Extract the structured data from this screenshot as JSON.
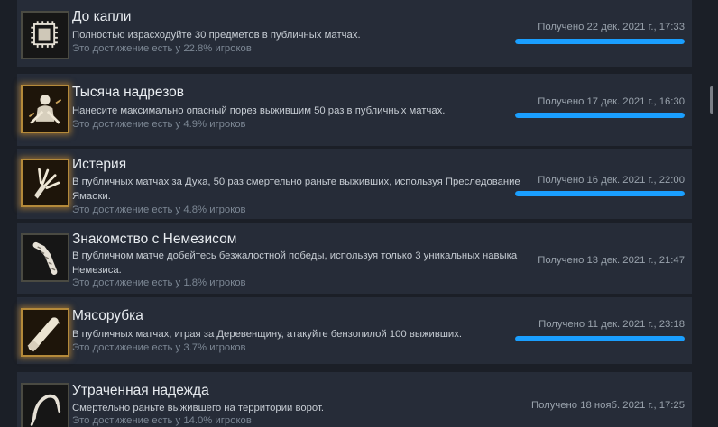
{
  "achievements": [
    {
      "title": "До капли",
      "description": "Полностью израсходуйте 30 предметов в публичных матчах.",
      "percent": "Это достижение есть у 22.8% игроков",
      "unlocked": "Получено 22 дек. 2021 г., 17:33",
      "progress": 1.0,
      "icon": "box-icon"
    },
    {
      "title": "Тысяча надрезов",
      "description": "Нанесите максимально опасный порез выжившим 50 раз в публичных матчах.",
      "percent": "Это достижение есть у 4.9% игроков",
      "unlocked": "Получено 17 дек. 2021 г., 16:30",
      "progress": 1.0,
      "icon": "cutter-icon"
    },
    {
      "title": "Истерия",
      "description": "В публичных матчах за Духа, 50 раз смертельно раньте выживших, используя Преследование Ямаоки.",
      "percent": "Это достижение есть у 4.8% игроков",
      "unlocked": "Получено 16 дек. 2021 г., 22:00",
      "progress": 1.0,
      "icon": "claw-icon"
    },
    {
      "title": "Знакомство с Немезисом",
      "description": "В публичном матче добейтесь безжалостной победы, используя только 3 уникальных навыка Немезиса.",
      "percent": "Это достижение есть у 1.8% игроков",
      "unlocked": "Получено 13 дек. 2021 г., 21:47",
      "progress": null,
      "icon": "tentacle-icon"
    },
    {
      "title": "Мясорубка",
      "description": "В публичных матчах, играя за Деревенщину, атакуйте бензопилой 100 выживших.",
      "percent": "Это достижение есть у 3.7% игроков",
      "unlocked": "Получено 11 дек. 2021 г., 23:18",
      "progress": 1.0,
      "icon": "chainsaw-icon"
    },
    {
      "title": "Утраченная надежда",
      "description": "Смертельно раньте выжившего на территории ворот.",
      "percent": "Это достижение есть у 14.0% игроков",
      "unlocked": "Получено 18 нояб. 2021 г., 17:25",
      "progress": null,
      "icon": "hook-icon"
    }
  ],
  "colors": {
    "row_bg": "#262c38",
    "progress": "#1a9fff",
    "gold_glow": "#d69632"
  }
}
